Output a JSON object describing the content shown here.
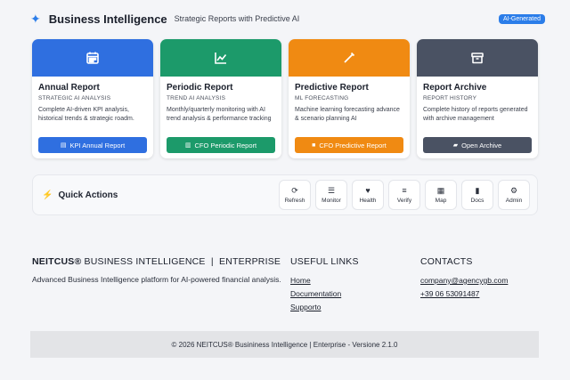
{
  "header": {
    "title": "Business Intelligence",
    "subtitle": "Strategic Reports with Predictive AI",
    "badge": "AI-Generated",
    "icon": "sparkle-icon"
  },
  "cards": [
    {
      "title": "Annual Report",
      "tag": "STRATEGIC AI ANALYSIS",
      "description": "Complete AI-driven KPI analysis, historical trends & strategic roadm.",
      "button": "KPI Annual Report",
      "icon": "calendar-icon",
      "color": "#2f6fe0"
    },
    {
      "title": "Periodic Report",
      "tag": "TREND AI ANALYSIS",
      "description": "Monthly/quarterly monitoring with AI trend analysis & performance tracking",
      "button": "CFO Periodic Report",
      "icon": "line-chart-icon",
      "color": "#1c9a6a"
    },
    {
      "title": "Predictive Report",
      "tag": "ML FORECASTING",
      "description": "Machine learning forecasting advance & scenario planning AI",
      "button": "CFO Predictive Report",
      "icon": "magic-wand-icon",
      "color": "#f08a12"
    },
    {
      "title": "Report Archive",
      "tag": "REPORT HISTORY",
      "description": "Complete history of reports generated with archive management",
      "button": "Open Archive",
      "icon": "archive-box-icon",
      "color": "#4a5263"
    }
  ],
  "quick_actions": {
    "title": "Quick Actions",
    "items": [
      {
        "label": "Refresh",
        "icon": "refresh-icon"
      },
      {
        "label": "Monitor",
        "icon": "list-check-icon"
      },
      {
        "label": "Health",
        "icon": "heart-pulse-icon"
      },
      {
        "label": "Verify",
        "icon": "database-icon"
      },
      {
        "label": "Map",
        "icon": "map-icon"
      },
      {
        "label": "Docs",
        "icon": "book-icon"
      },
      {
        "label": "Admin",
        "icon": "gears-icon"
      }
    ]
  },
  "footer": {
    "brand_name": "NEITCUS®",
    "brand_rest": " BUSINESS INTELLIGENCE  |  ENTERPRISE",
    "description": "Advanced Business Intelligence platform for AI-powered financial analysis.",
    "links_title": "USEFUL LINKS",
    "links": [
      "Home",
      "Documentation",
      "Supporto"
    ],
    "contacts_title": "CONTACTS",
    "contacts": [
      "company@agencygb.com",
      "+39 06 53091487"
    ],
    "copyright": "© 2026 NEITCUS® Busininess Intelligence | Enterprise - Versione 2.1.0"
  }
}
